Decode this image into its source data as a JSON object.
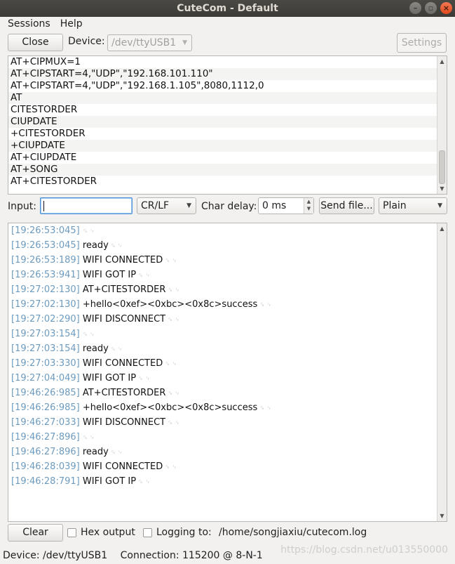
{
  "window": {
    "title": "CuteCom - Default"
  },
  "menu": {
    "sessions": "Sessions",
    "help": "Help"
  },
  "toolbar": {
    "close_label": "Close",
    "device_label": "Device:",
    "device_value": "/dev/ttyUSB1",
    "settings_label": "Settings"
  },
  "history": [
    "AT+CIPMUX=1",
    "AT+CIPSTART=4,\"UDP\",\"192.168.101.110\"",
    "AT+CIPSTART=4,\"UDP\",\"192.168.1.105\",8080,1112,0",
    "AT",
    "CITESTORDER",
    "CIUPDATE",
    "+CITESTORDER",
    "+CIUPDATE",
    "AT+CIUPDATE",
    "AT+SONG",
    "AT+CITESTORDER"
  ],
  "input_row": {
    "input_label": "Input:",
    "input_value": "",
    "line_end": "CR/LF",
    "char_delay_label": "Char delay:",
    "char_delay_value": "0 ms",
    "send_file_label": "Send file...",
    "format": "Plain"
  },
  "output": [
    {
      "ts": "[19:26:53:045]",
      "text": ""
    },
    {
      "ts": "[19:26:53:045]",
      "text": "ready"
    },
    {
      "ts": "[19:26:53:189]",
      "text": "WIFI CONNECTED"
    },
    {
      "ts": "[19:26:53:941]",
      "text": "WIFI GOT IP"
    },
    {
      "ts": "[19:27:02:130]",
      "text": "AT+CITESTORDER"
    },
    {
      "ts": "[19:27:02:130]",
      "text": "+hello<0xef><0xbc><0x8c>success"
    },
    {
      "ts": "[19:27:02:290]",
      "text": "WIFI DISCONNECT"
    },
    {
      "ts": "[19:27:03:154]",
      "text": ""
    },
    {
      "ts": "[19:27:03:154]",
      "text": "ready"
    },
    {
      "ts": "[19:27:03:330]",
      "text": "WIFI CONNECTED"
    },
    {
      "ts": "[19:27:04:049]",
      "text": "WIFI GOT IP"
    },
    {
      "ts": "[19:46:26:985]",
      "text": "AT+CITESTORDER"
    },
    {
      "ts": "[19:46:26:985]",
      "text": "+hello<0xef><0xbc><0x8c>success"
    },
    {
      "ts": "[19:46:27:033]",
      "text": "WIFI DISCONNECT"
    },
    {
      "ts": "[19:46:27:896]",
      "text": ""
    },
    {
      "ts": "[19:46:27:896]",
      "text": "ready"
    },
    {
      "ts": "[19:46:28:039]",
      "text": "WIFI CONNECTED"
    },
    {
      "ts": "[19:46:28:791]",
      "text": "WIFI GOT IP"
    }
  ],
  "bottom": {
    "clear_label": "Clear",
    "hex_output_label": "Hex output",
    "logging_label": "Logging to:",
    "log_path": "/home/songjiaxiu/cutecom.log"
  },
  "status": {
    "device": "Device:  /dev/ttyUSB1",
    "connection": "Connection:  115200 @ 8-N-1"
  },
  "watermark": "https://blog.csdn.net/u013550000"
}
